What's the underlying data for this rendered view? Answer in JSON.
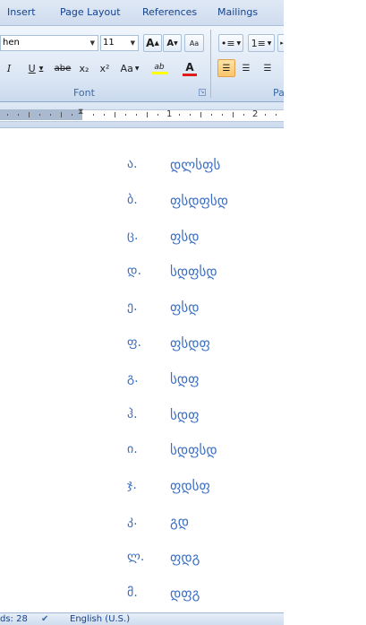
{
  "tabs": [
    "Insert",
    "Page Layout",
    "References",
    "Mailings"
  ],
  "ribbon": {
    "font_name": "hen",
    "font_size": "11",
    "grow_label": "A",
    "shrink_label": "A",
    "clear_label": "Aa",
    "bullets_label": "•≡",
    "numbering_label": "1≡",
    "italic_label": "I",
    "underline_label": "U",
    "strike_label": "abe",
    "sub_label": "x₂",
    "sup_label": "x²",
    "case_label": "Aa",
    "highlight_label": "ab",
    "fontcolor_label": "A",
    "font_group_label": "Font",
    "para_group_label": "Pa"
  },
  "ruler": {
    "num1": "1",
    "num2": "2"
  },
  "document": {
    "items": [
      {
        "num": "ა.",
        "text": "დლსფს"
      },
      {
        "num": "ბ.",
        "text": "ფსდფსდ"
      },
      {
        "num": "ც.",
        "text": "ფსდ"
      },
      {
        "num": "დ.",
        "text": "სდფსდ"
      },
      {
        "num": "ე.",
        "text": "ფსდ"
      },
      {
        "num": "ფ.",
        "text": "ფსდფ"
      },
      {
        "num": "გ.",
        "text": "სდფ"
      },
      {
        "num": "ჰ.",
        "text": "სდფ"
      },
      {
        "num": "ი.",
        "text": "სდფსდ"
      },
      {
        "num": "ჯ.",
        "text": "ფდსფ"
      },
      {
        "num": "კ.",
        "text": "გდ"
      },
      {
        "num": "ლ.",
        "text": "ფდგ"
      },
      {
        "num": "მ.",
        "text": "დფგ"
      }
    ]
  },
  "status": {
    "words": "ds: 28",
    "language": "English (U.S.)"
  },
  "colors": {
    "list_text": "#3b6ec2",
    "ribbon_text": "#15428b",
    "highlight": "#ffff00",
    "font_color": "#e01b1b"
  }
}
